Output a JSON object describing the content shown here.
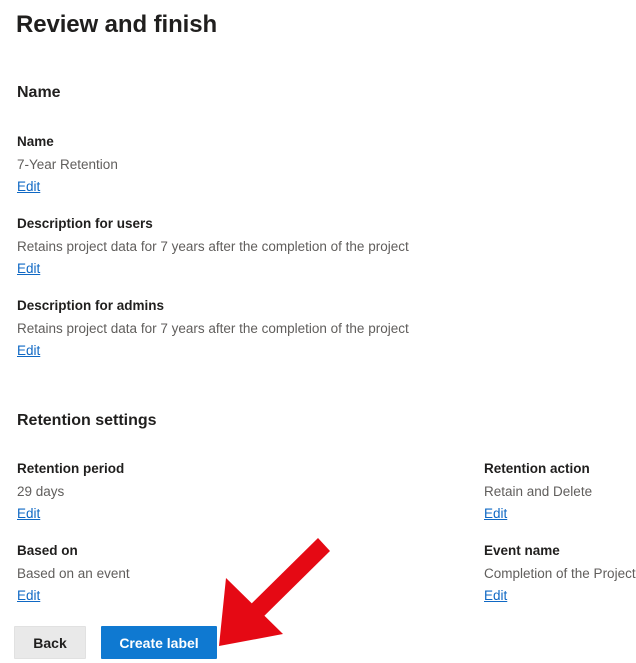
{
  "page": {
    "title": "Review and finish"
  },
  "sections": {
    "name": {
      "heading": "Name",
      "fields": [
        {
          "label": "Name",
          "value": "7-Year Retention",
          "edit_label": "Edit"
        },
        {
          "label": "Description for users",
          "value": "Retains project data for 7 years after the completion of the project",
          "edit_label": "Edit"
        },
        {
          "label": "Description for admins",
          "value": "Retains project data for 7 years after the completion of the project",
          "edit_label": "Edit"
        }
      ]
    },
    "retention_settings": {
      "heading": "Retention settings",
      "fields": [
        {
          "label": "Retention period",
          "value": "29 days",
          "edit_label": "Edit"
        },
        {
          "label": "Retention action",
          "value": "Retain and Delete",
          "edit_label": "Edit"
        },
        {
          "label": "Based on",
          "value": "Based on an event",
          "edit_label": "Edit"
        },
        {
          "label": "Event name",
          "value": "Completion of the Project",
          "edit_label": "Edit"
        }
      ]
    }
  },
  "footer": {
    "back_label": "Back",
    "create_label": "Create label"
  },
  "annotation": {
    "arrow_name": "red-arrow-annotation",
    "arrow_color": "#e50914",
    "points_to": "Create label"
  },
  "colors": {
    "primary_button": "#0f79d1",
    "secondary_button": "#e9e9e9",
    "link": "#0f68c4",
    "heading_text": "#201f1e",
    "value_text": "#605e5c",
    "background": "#ffffff",
    "annotation_red": "#e50914"
  }
}
